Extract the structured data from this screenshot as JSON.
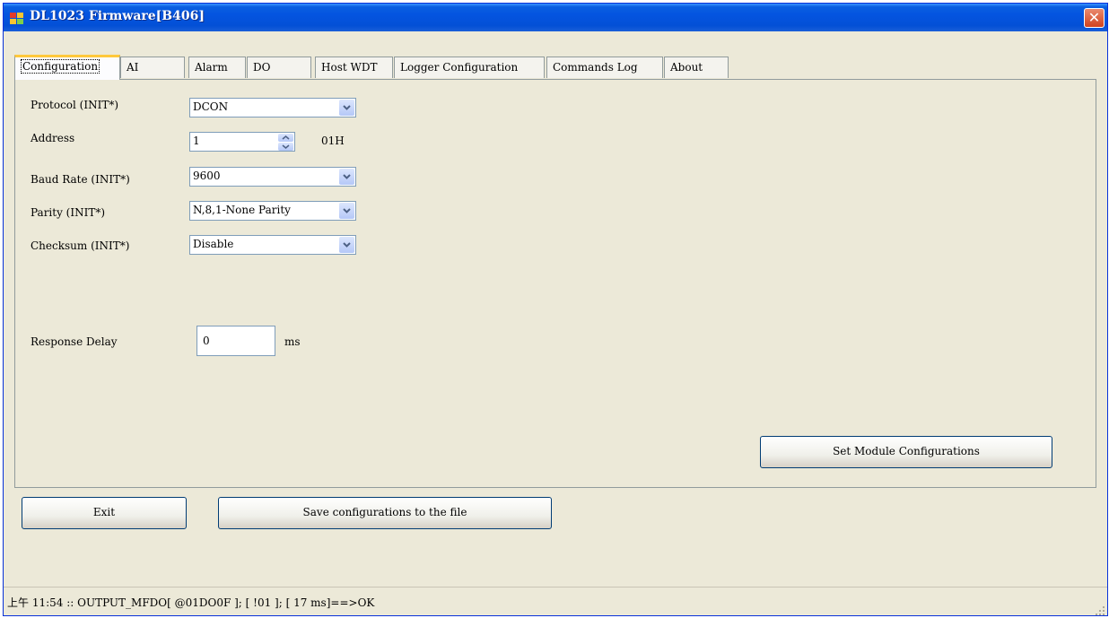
{
  "window": {
    "title": "DL1023 Firmware[B406]",
    "close_icon": "close-icon"
  },
  "tabs": [
    {
      "label": "Configuration",
      "active": true
    },
    {
      "label": "AI"
    },
    {
      "label": "Alarm"
    },
    {
      "label": "DO"
    },
    {
      "label": "Host WDT"
    },
    {
      "label": "Logger Configuration"
    },
    {
      "label": "Commands Log"
    },
    {
      "label": "About"
    }
  ],
  "config": {
    "protocol": {
      "label": "Protocol (INIT*)",
      "value": "DCON"
    },
    "address": {
      "label": "Address",
      "value": "1",
      "hex": "01H"
    },
    "baud_rate": {
      "label": "Baud Rate (INIT*)",
      "value": "9600"
    },
    "parity": {
      "label": "Parity (INIT*)",
      "value": "N,8,1-None Parity"
    },
    "checksum": {
      "label": "Checksum (INIT*)",
      "value": "Disable"
    },
    "response_delay": {
      "label": "Response Delay",
      "value": "0",
      "unit": "ms"
    },
    "set_button": "Set Module Configurations"
  },
  "buttons": {
    "exit": "Exit",
    "save": "Save configurations to the file"
  },
  "status": {
    "text": "上午 11:54 :: OUTPUT_MFDO[ @01DO0F ]; [ !01 ]; [ 17 ms]==>OK"
  },
  "colors": {
    "titlebar": "#0454e0",
    "window_bg": "#ece9d8",
    "active_tab_accent": "#ffc83c"
  }
}
